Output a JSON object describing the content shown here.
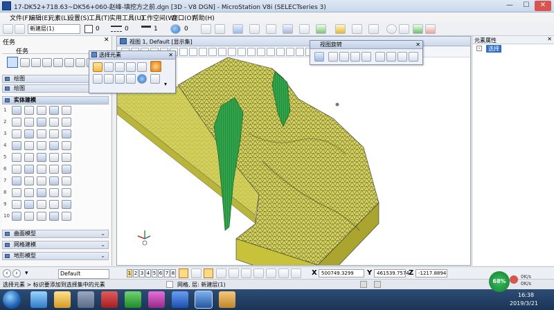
{
  "window": {
    "title": "17-DK52+718.63~DK56+060-赵峰-填挖方之前.dgn [3D - V8 DGN] - MicroStation V8i (SELECTseries 3)",
    "minimize": "—",
    "maximize": "☐",
    "close": "✕"
  },
  "menu": [
    "文件(F)",
    "编辑(E)",
    "元素(L)",
    "设置(S)",
    "工具(T)",
    "实用工具(U)",
    "工作空间(W)",
    "窗口(O)",
    "帮助(H)"
  ],
  "toolbar": {
    "level_combo": "新建层(1)",
    "color_value": "0",
    "linestyle_value": "0",
    "weight_value": "1",
    "transparency_value": "0"
  },
  "task_panel": {
    "header": "任务",
    "tasks_label": "任务",
    "sections": [
      "绘图",
      "绘图",
      "实体建模",
      "曲面模型",
      "网格建模",
      "地形模型"
    ],
    "row_numbers": [
      "1",
      "2",
      "3",
      "4",
      "5",
      "6",
      "7",
      "8",
      "9",
      "10"
    ]
  },
  "view": {
    "title": "视图 1, Default [显示集]",
    "colors": {
      "terrain_top": "#d4d25a",
      "terrain_side": "#c8c23a",
      "wall_green": "#2fa44a",
      "mesh_line": "#2a2a20"
    }
  },
  "palette_select": {
    "title": "选择元素"
  },
  "palette_view_rotation": {
    "title": "视图旋转"
  },
  "props_panel": {
    "title": "元素属性",
    "selected_item": "选择"
  },
  "snap_bar": {
    "model_combo": "Default",
    "view_numbers": [
      "1",
      "2",
      "3",
      "4",
      "5",
      "6",
      "7",
      "8"
    ],
    "x_label": "X",
    "x_value": "500749.3299",
    "y_label": "Y",
    "y_value": "461539.7574",
    "z_label": "Z",
    "z_value": "-1217.8894"
  },
  "status_bar": {
    "prompt": "选择元素 > 标识要添加到选择集中的元素",
    "level_info": "网格, 层: 新建层(1)"
  },
  "taskbar": {
    "cpu_percent": "68%",
    "net_up": "0K/s",
    "net_down": "0K/s",
    "time": "16:38",
    "date": "2019/3/21"
  }
}
